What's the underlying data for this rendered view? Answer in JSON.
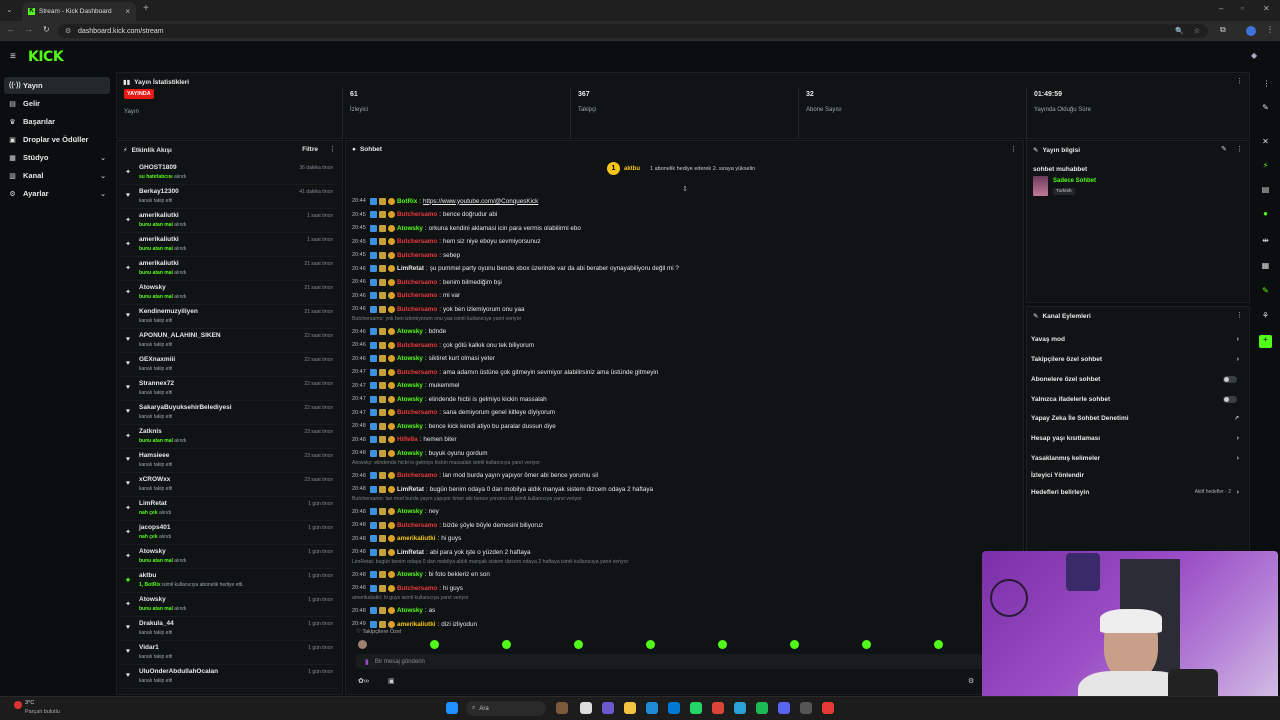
{
  "browser": {
    "tab_title": "Stream - Kick Dashboard",
    "url": "dashboard.kick.com/stream"
  },
  "brand": {
    "logo": "KICK",
    "accent": "#53fc18",
    "live_color": "#e91916"
  },
  "sidebar": {
    "items": [
      {
        "label": "Yayın",
        "icon": "broadcast-icon",
        "active": true
      },
      {
        "label": "Gelir",
        "icon": "money-icon"
      },
      {
        "label": "Başarılar",
        "icon": "trophy-icon"
      },
      {
        "label": "Droplar ve Ödüller",
        "icon": "gift-icon"
      },
      {
        "label": "Stüdyo",
        "icon": "studio-icon",
        "expandable": true
      },
      {
        "label": "Kanal",
        "icon": "channel-icon",
        "expandable": true
      },
      {
        "label": "Ayarlar",
        "icon": "gear-icon",
        "expandable": true
      }
    ]
  },
  "stats": {
    "title": "Yayın İstatistikleri",
    "live_badge": "YAYINDA",
    "cards": [
      {
        "label": "Yayın",
        "value": ""
      },
      {
        "value": "61",
        "label": "İzleyici"
      },
      {
        "value": "367",
        "label": "Takipçi"
      },
      {
        "value": "32",
        "label": "Abone Sayısı"
      },
      {
        "value": "01:49:59",
        "label": "Yayında Olduğu Süre"
      }
    ]
  },
  "activity": {
    "title": "Etkinlik Akışı",
    "filter": "Filtre",
    "items": [
      {
        "name": "GHOST1809",
        "detail_pre": "",
        "detail_hl": "su hatırlatıcısı",
        "detail_post": " alındı",
        "time": "36 dakika önce",
        "icon": "gift"
      },
      {
        "name": "Berkay12300",
        "detail_pre": "kanalı takip etti",
        "detail_hl": "",
        "detail_post": "",
        "time": "41 dakika önce",
        "icon": "heart"
      },
      {
        "name": "amerikaliutki",
        "detail_pre": "",
        "detail_hl": "bunu atan mal",
        "detail_post": " alındı",
        "time": "1 saat önce",
        "icon": "gift"
      },
      {
        "name": "amerikaliutki",
        "detail_pre": "",
        "detail_hl": "bunu atan mal",
        "detail_post": " alındı",
        "time": "1 saat önce",
        "icon": "gift"
      },
      {
        "name": "amerikaliutki",
        "detail_pre": "",
        "detail_hl": "bunu atan mal",
        "detail_post": " alındı",
        "time": "21 saat önce",
        "icon": "gift"
      },
      {
        "name": "Atowsky",
        "detail_pre": "",
        "detail_hl": "bunu atan mal",
        "detail_post": " alındı",
        "time": "21 saat önce",
        "icon": "gift"
      },
      {
        "name": "Kendinemuzyiliyen",
        "detail_pre": "kanalı takip etti",
        "detail_hl": "",
        "detail_post": "",
        "time": "21 saat önce",
        "icon": "heart"
      },
      {
        "name": "APONUN_ALAHINI_SIKEN",
        "detail_pre": "kanalı takip etti",
        "detail_hl": "",
        "detail_post": "",
        "time": "22 saat önce",
        "icon": "heart"
      },
      {
        "name": "GEXnaxmiii",
        "detail_pre": "kanalı takip etti",
        "detail_hl": "",
        "detail_post": "",
        "time": "22 saat önce",
        "icon": "heart"
      },
      {
        "name": "Strannex72",
        "detail_pre": "kanalı takip etti",
        "detail_hl": "",
        "detail_post": "",
        "time": "22 saat önce",
        "icon": "heart"
      },
      {
        "name": "SakaryaBuyuksehirBelediyesi",
        "detail_pre": "kanalı takip etti",
        "detail_hl": "",
        "detail_post": "",
        "time": "22 saat önce",
        "icon": "heart"
      },
      {
        "name": "Zatknis",
        "detail_pre": "",
        "detail_hl": "bunu atan mal",
        "detail_post": " alındı",
        "time": "23 saat önce",
        "icon": "gift"
      },
      {
        "name": "Hamsieee",
        "detail_pre": "kanalı takip etti",
        "detail_hl": "",
        "detail_post": "",
        "time": "23 saat önce",
        "icon": "heart"
      },
      {
        "name": "xCROWxx",
        "detail_pre": "kanalı takip etti",
        "detail_hl": "",
        "detail_post": "",
        "time": "23 saat önce",
        "icon": "heart"
      },
      {
        "name": "LimRetat",
        "detail_pre": "",
        "detail_hl": "nah çek",
        "detail_post": " alındı",
        "time": "1 gün önce",
        "icon": "gift"
      },
      {
        "name": "jacops401",
        "detail_pre": "",
        "detail_hl": "nah çek",
        "detail_post": " alındı",
        "time": "1 gün önce",
        "icon": "gift"
      },
      {
        "name": "Atowsky",
        "detail_pre": "",
        "detail_hl": "bunu atan mal",
        "detail_post": " alındı",
        "time": "1 gün önce",
        "icon": "gift"
      },
      {
        "name": "aktbu",
        "detail_pre": "",
        "detail_hl": "1, BotRix",
        "detail_post": " isimli kullanıcıya abonelik hediye etti.",
        "time": "1 gün önce",
        "icon": "sub"
      },
      {
        "name": "Atowsky",
        "detail_pre": "",
        "detail_hl": "bunu atan mal",
        "detail_post": " alındı",
        "time": "1 gün önce",
        "icon": "gift"
      },
      {
        "name": "Drakula_44",
        "detail_pre": "kanalı takip etti",
        "detail_hl": "",
        "detail_post": "",
        "time": "1 gün önce",
        "icon": "heart"
      },
      {
        "name": "Vidar1",
        "detail_pre": "kanalı takip etti",
        "detail_hl": "",
        "detail_post": "",
        "time": "1 gün önce",
        "icon": "heart"
      },
      {
        "name": "UluOnderAbdullahOcalan",
        "detail_pre": "kanalı takip etti",
        "detail_hl": "",
        "detail_post": "",
        "time": "1 gün önce",
        "icon": "heart"
      }
    ]
  },
  "chat": {
    "title": "Sohbet",
    "pinned_user": "aktbu",
    "pinned_text": "1 abonelik hediye ederek 2. sıraya yükselin",
    "input_placeholder": "Bir mesaj gönderin",
    "followers_only": "Takipçilere Özel",
    "messages": [
      {
        "type": "msg",
        "time": "20:44",
        "user": "BotRix",
        "color": "#53fc18",
        "text": "https://www.youtube.com/@ConquesKick",
        "link": true
      },
      {
        "type": "msg",
        "time": "20:45",
        "user": "Butchersamo",
        "color": "#e8393f",
        "text": "bence doğrudur abi"
      },
      {
        "type": "msg",
        "time": "20:45",
        "user": "Atowsky",
        "color": "#53fc18",
        "text": "orkuna kendini aklamasi icin para vermis olabilirmi ebo"
      },
      {
        "type": "msg",
        "time": "20:45",
        "user": "Butchersamo",
        "color": "#e8393f",
        "text": "hem siz niye eboyu sevmiyorsunuz"
      },
      {
        "type": "msg",
        "time": "20:45",
        "user": "Butchersamo",
        "color": "#e8393f",
        "text": "sebep"
      },
      {
        "type": "msg",
        "time": "20:46",
        "user": "LimRetat",
        "color": "#e7e7e7",
        "text": "şu pummel party oyunu bende xbox üzerinde var da abi beraber oynayabiliyoru değil mi ?"
      },
      {
        "type": "msg",
        "time": "20:46",
        "user": "Butchersamo",
        "color": "#e8393f",
        "text": "benim bilmediğim bşi"
      },
      {
        "type": "msg",
        "time": "20:46",
        "user": "Butchersamo",
        "color": "#e8393f",
        "text": "mi var"
      },
      {
        "type": "msg",
        "time": "20:46",
        "user": "Butchersamo",
        "color": "#e8393f",
        "text": "yok ben izlemiyorum onu yaa"
      },
      {
        "type": "reply",
        "text": "Butchersamo: yok ben izlemiyorum onu yaa isimli kullanıcıya yanıt veriyor"
      },
      {
        "type": "msg",
        "time": "20:46",
        "user": "Atowsky",
        "color": "#53fc18",
        "text": "bdnde"
      },
      {
        "type": "msg",
        "time": "20:46",
        "user": "Butchersamo",
        "color": "#e8393f",
        "text": "çok götü kalkık onu tek biliyorum"
      },
      {
        "type": "msg",
        "time": "20:46",
        "user": "Atowsky",
        "color": "#53fc18",
        "text": "siktiret kurt olmasi yeter"
      },
      {
        "type": "msg",
        "time": "20:47",
        "user": "Butchersamo",
        "color": "#e8393f",
        "text": "ama adamın üstüne çok gitmeyin sevmiyor alabilirsiniz ama üstünde gitmeyin"
      },
      {
        "type": "msg",
        "time": "20:47",
        "user": "Atowsky",
        "color": "#53fc18",
        "text": "mukemmel"
      },
      {
        "type": "msg",
        "time": "20:47",
        "user": "Atowsky",
        "color": "#53fc18",
        "text": "elindende hicbi is gelmiyo kickin massalah"
      },
      {
        "type": "msg",
        "time": "20:47",
        "user": "Butchersamo",
        "color": "#e8393f",
        "text": "sana demiyorum genel kitleye diyiyorum"
      },
      {
        "type": "msg",
        "time": "20:48",
        "user": "Atowsky",
        "color": "#53fc18",
        "text": "bence kick kendi atiyo bu paralar dussun diye"
      },
      {
        "type": "msg",
        "time": "20:48",
        "user": "Hilfe8a",
        "color": "#e8393f",
        "text": "hemen biter"
      },
      {
        "type": "msg",
        "time": "20:48",
        "user": "Atowsky",
        "color": "#53fc18",
        "text": "buyuk oyunu gordum"
      },
      {
        "type": "reply",
        "text": "Atowsky: elindende hicbi is gelmiyo kickin massalah isimli kullanıcıya yanıt veriyor"
      },
      {
        "type": "msg",
        "time": "20:48",
        "user": "Butchersamo",
        "color": "#e8393f",
        "text": "lan mod burda yayın yapıyor ömer abi bence yorumu sil"
      },
      {
        "type": "msg",
        "time": "20:48",
        "user": "LimRetat",
        "color": "#e7e7e7",
        "text": "bugün benim odaya 0 dan mobilya aldık manyak sistem dizcem odaya 2 haftaya"
      },
      {
        "type": "reply",
        "text": "Butchersamo: lan mod burda yayın yapıyor ömer abi bence yorumu sil isimli kullanıcıya yanıt veriyor"
      },
      {
        "type": "msg",
        "time": "20:48",
        "user": "Atowsky",
        "color": "#53fc18",
        "text": "ney"
      },
      {
        "type": "msg",
        "time": "20:48",
        "user": "Butchersamo",
        "color": "#e8393f",
        "text": "bizde şöyle böyle demesini biliyoruz"
      },
      {
        "type": "msg",
        "time": "20:48",
        "user": "amerikaliutki",
        "color": "#f5c518",
        "text": "hi guys"
      },
      {
        "type": "msg",
        "time": "20:48",
        "user": "LimRetat",
        "color": "#e7e7e7",
        "text": "abi para yok işte o yüzden 2 haftaya"
      },
      {
        "type": "reply",
        "text": "LimRetat: bugün benim odaya 0 dan mobilya aldık manyak sistem dizcem odaya 2 haftaya isimli kullanıcıya yanıt veriyor"
      },
      {
        "type": "msg",
        "time": "20:48",
        "user": "Atowsky",
        "color": "#53fc18",
        "text": "bi foto bekleriz en son"
      },
      {
        "type": "msg",
        "time": "20:48",
        "user": "Butchersamo",
        "color": "#e8393f",
        "text": "hi guys"
      },
      {
        "type": "reply",
        "text": "amerikaliutki: hi guys isimli kullanıcıya yanıt veriyor"
      },
      {
        "type": "msg",
        "time": "20:48",
        "user": "Atowsky",
        "color": "#53fc18",
        "text": "as"
      },
      {
        "type": "msg",
        "time": "20:49",
        "user": "amerikaliutki",
        "color": "#f5c518",
        "text": "dizi izliyodun"
      }
    ]
  },
  "stream_info": {
    "title": "Yayın bilgisi",
    "stream_title": "sohbet muhabbet",
    "category": "Sadece Sohbet",
    "language": "Turkish"
  },
  "channel_actions": {
    "title": "Kanal Eylemleri",
    "items": [
      {
        "label": "Yavaş mod",
        "control": "chevron"
      },
      {
        "label": "Takipçilere özel sohbet",
        "control": "chevron"
      },
      {
        "label": "Abonelere özel sohbet",
        "control": "toggle"
      },
      {
        "label": "Yalnızca ifadelerle sohbet",
        "control": "toggle"
      },
      {
        "label": "Yapay Zeka İle Sohbet Denetimi",
        "control": "external"
      },
      {
        "label": "Hesap yaşı kısıtlaması",
        "control": "chevron"
      },
      {
        "label": "Yasaklanmış kelimeler",
        "control": "chevron"
      },
      {
        "label": "İzleyici Yönlendir",
        "control": "none"
      },
      {
        "label": "Hedefleri belirleyin",
        "control": "chevron",
        "note": "Aktif hedefler · 2"
      }
    ]
  },
  "taskbar": {
    "weather_temp": "3°C",
    "weather_text": "Parçalı bulutlu",
    "search": "Ara"
  }
}
